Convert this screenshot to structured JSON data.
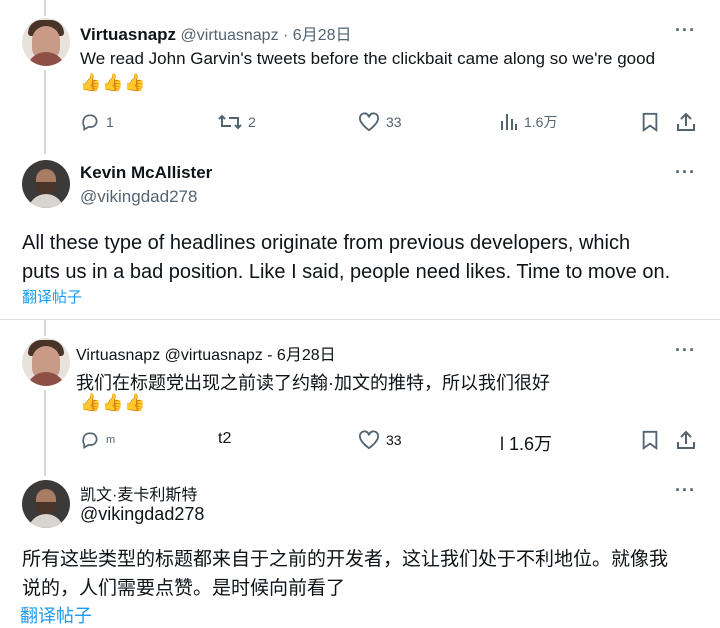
{
  "top": {
    "reply": {
      "name": "Virtuasnapz",
      "handle": "@virtuasnapz",
      "date": "· 6月28日",
      "text": "We read John Garvin's tweets before the clickbait came along so we're good",
      "emojis": "👍👍👍",
      "stats": {
        "replies": "1",
        "retweets": "2",
        "likes": "33",
        "views": "1.6万"
      }
    },
    "post": {
      "name": "Kevin McAllister",
      "handle": "@vikingdad278",
      "text_line1": "All these type of headlines originate from previous developers, which",
      "text_line2": "puts us in a bad position. Like I said, people need likes. Time to move on.",
      "translate": "翻译帖子"
    }
  },
  "bottom": {
    "reply": {
      "header": "Virtuasnapz @virtuasnapz - 6月28日",
      "text": "我们在标题党出现之前读了约翰·加文的推特，所以我们很好",
      "emojis": "👍👍👍",
      "stats": {
        "replies": "m",
        "retweets": "t2",
        "likes": "33",
        "views": "l 1.6万"
      }
    },
    "post": {
      "name": "凯文·麦卡利斯特",
      "handle": "@vikingdad278",
      "text_line1": "所有这些类型的标题都来自于之前的开发者，这让我们处于不利地位。就像我",
      "text_line2": "说的，人们需要点赞。是时候向前看了",
      "translate": "翻译帖子"
    }
  },
  "colors": {
    "accent": "#1d9bf0",
    "secondary_text": "#536471",
    "thread_line": "#cfd9de"
  },
  "icons": [
    "reply-icon",
    "retweet-icon",
    "like-icon",
    "views-icon",
    "bookmark-icon",
    "share-icon",
    "more-icon"
  ]
}
